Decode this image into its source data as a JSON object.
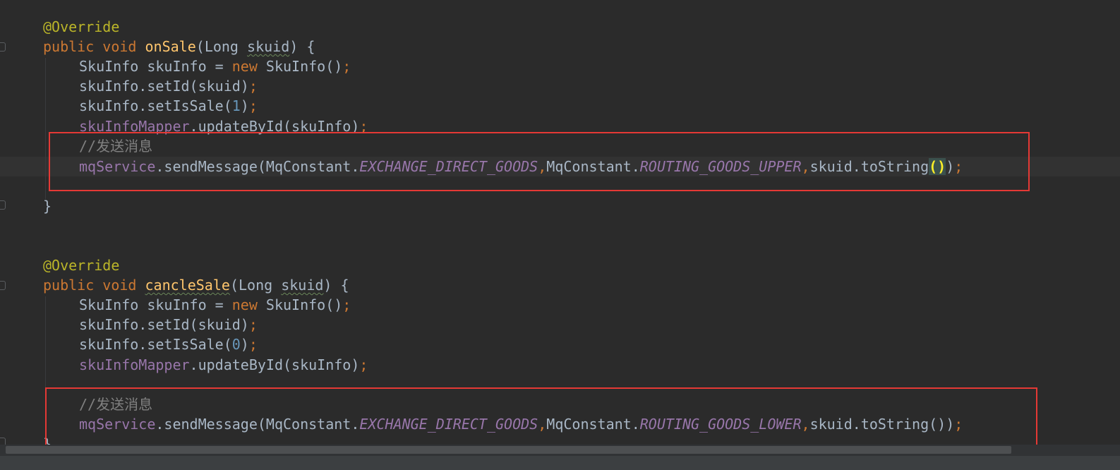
{
  "editor": {
    "method1": {
      "annotation": "@Override",
      "kw_public": "public",
      "kw_void": "void",
      "name": "onSale",
      "param_open": "(",
      "param_type": "Long",
      "param_name": "skuid",
      "param_close": ") {",
      "line1": {
        "type": "SkuInfo skuInfo = ",
        "kw_new": "new",
        "ctor": " SkuInfo()",
        "semi": ";"
      },
      "line2": {
        "call": "skuInfo.setId(skuid)",
        "semi": ";"
      },
      "line3": {
        "call_start": "skuInfo.setIsSale(",
        "num": "1",
        "call_end": ")",
        "semi": ";"
      },
      "line4": {
        "field": "skuInfoMapper",
        "call": ".updateById(skuInfo)",
        "semi": ";"
      },
      "comment": "//发送消息",
      "send": {
        "field": "mqService",
        "call_start": ".sendMessage(MqConstant.",
        "const1": "EXCHANGE_DIRECT_GOODS",
        "comma1": ",",
        "mid": "MqConstant.",
        "const2": "ROUTING_GOODS_UPPER",
        "comma2": ",",
        "tail": "skuid.toString",
        "parens": "()",
        "close": ")",
        "semi": ";"
      },
      "closing": "}"
    },
    "method2": {
      "annotation": "@Override",
      "kw_public": "public",
      "kw_void": "void",
      "name": "cancleSale",
      "param_open": "(",
      "param_type": "Long",
      "param_name": "skuid",
      "param_close": ") {",
      "line1": {
        "type": "SkuInfo skuInfo = ",
        "kw_new": "new",
        "ctor": " SkuInfo()",
        "semi": ";"
      },
      "line2": {
        "call": "skuInfo.setId(skuid)",
        "semi": ";"
      },
      "line3": {
        "call_start": "skuInfo.setIsSale(",
        "num": "0",
        "call_end": ")",
        "semi": ";"
      },
      "line4": {
        "field": "skuInfoMapper",
        "call": ".updateById(skuInfo)",
        "semi": ";"
      },
      "comment": "//发送消息",
      "send": {
        "field": "mqService",
        "call_start": ".sendMessage(MqConstant.",
        "const1": "EXCHANGE_DIRECT_GOODS",
        "comma1": ",",
        "mid": "MqConstant.",
        "const2": "ROUTING_GOODS_LOWER",
        "comma2": ",",
        "tail": "skuid.toString())",
        "semi": ";"
      },
      "closing": "}"
    }
  },
  "colors": {
    "background": "#2b2b2b",
    "keyword": "#cc7832",
    "annotation": "#bbb529",
    "method_name": "#ffc66d",
    "field": "#9876aa",
    "number": "#6897bb",
    "comment": "#808080",
    "plain": "#a9b7c6",
    "highlight_box": "#e53935"
  }
}
